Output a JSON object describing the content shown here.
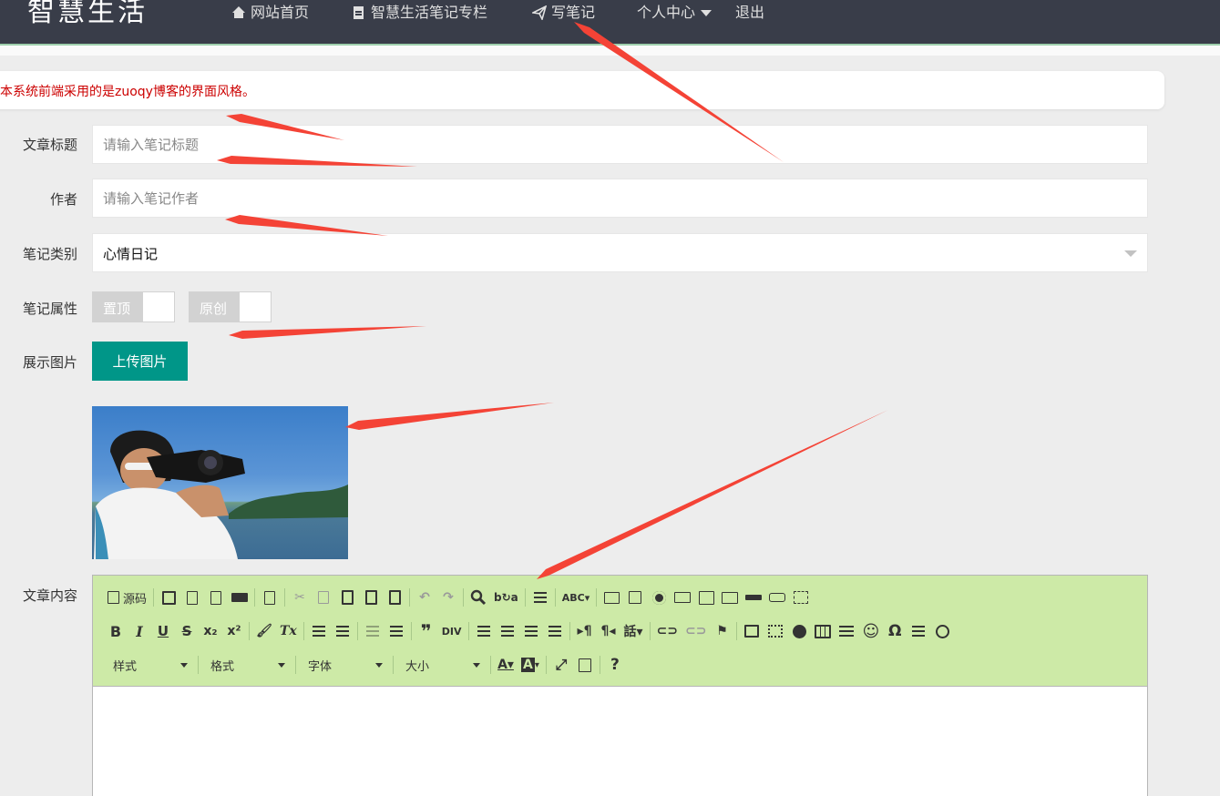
{
  "header": {
    "logo": "智慧生活",
    "nav": [
      {
        "label": "网站首页",
        "icon": "home-icon"
      },
      {
        "label": "智慧生活笔记专栏",
        "icon": "file-icon"
      },
      {
        "label": "写笔记",
        "icon": "paper-plane-icon"
      },
      {
        "label": "个人中心",
        "icon": "caret-down-icon"
      },
      {
        "label": "退出"
      }
    ]
  },
  "notice": "本系统前端采用的是zuoqy博客的界面风格。",
  "form": {
    "title": {
      "label": "文章标题",
      "placeholder": "请输入笔记标题",
      "value": ""
    },
    "author": {
      "label": "作者",
      "placeholder": "请输入笔记作者",
      "value": ""
    },
    "category": {
      "label": "笔记类别",
      "value": "心情日记"
    },
    "attributes": {
      "label": "笔记属性",
      "switches": [
        {
          "label": "置顶",
          "on": false
        },
        {
          "label": "原创",
          "on": false
        }
      ]
    },
    "image": {
      "label": "展示图片",
      "button": "上传图片"
    },
    "content": {
      "label": "文章内容"
    }
  },
  "editor": {
    "source_label": "源码",
    "combos": [
      "样式",
      "格式",
      "字体",
      "大小"
    ],
    "toolbar_bg": "#cdeaa7"
  },
  "colors": {
    "accent": "#009688",
    "topbar": "#393d49",
    "notice_text": "#cc0000",
    "annotation_arrow": "#f44336"
  }
}
